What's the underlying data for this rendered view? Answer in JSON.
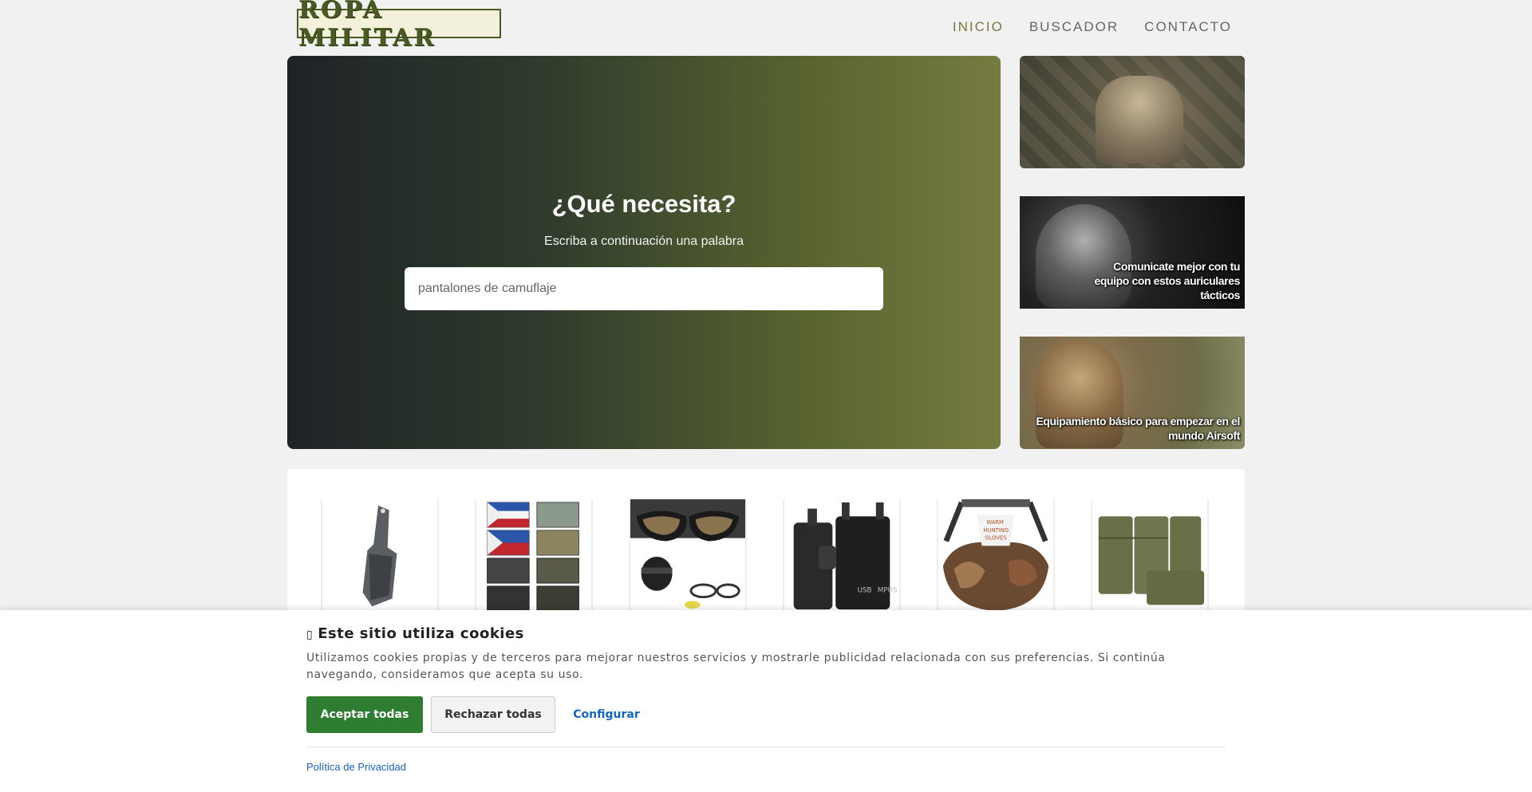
{
  "header": {
    "logo_text": "ROPA MILITAR",
    "nav": [
      {
        "label": "INICIO",
        "active": true
      },
      {
        "label": "BUSCADOR",
        "active": false
      },
      {
        "label": "CONTACTO",
        "active": false
      }
    ]
  },
  "hero": {
    "title": "¿Qué necesita?",
    "subtitle": "Escriba a continuación una palabra",
    "search_placeholder": "pantalones de camuflaje"
  },
  "side_banners": [
    {
      "caption": ""
    },
    {
      "caption": "Comunicate mejor con tu equipo con estos auriculares tácticos"
    },
    {
      "caption": "Equipamiento básico para empezar en el mundo Airsoft"
    }
  ],
  "products": [
    {
      "icon": "knife-icon"
    },
    {
      "icon": "patches-icon"
    },
    {
      "icon": "tactical-glasses-icon"
    },
    {
      "icon": "radio-adapter-icon"
    },
    {
      "icon": "hand-warmer-icon"
    },
    {
      "icon": "magazine-pouch-icon"
    }
  ],
  "cookie": {
    "icon": "cookie-icon",
    "title": "Este sitio utiliza cookies",
    "text": "Utilizamos cookies propias y de terceros para mejorar nuestros servicios y mostrarle publicidad relacionada con sus preferencias. Si continúa navegando, consideramos que acepta su uso.",
    "accept_label": "Aceptar todas",
    "reject_label": "Rechazar todas",
    "config_label": "Configurar",
    "privacy_label": "Política de Privacidad"
  },
  "colors": {
    "accent_olive": "#7b7a3d",
    "accept_green": "#2e7d32",
    "link_blue": "#1565c0"
  }
}
